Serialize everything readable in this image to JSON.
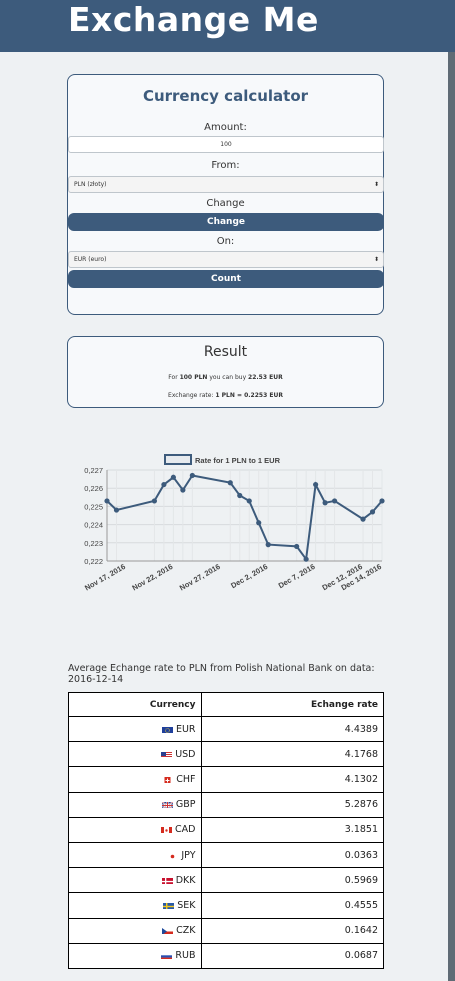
{
  "header": {
    "brand": "Exchange Me"
  },
  "calculator": {
    "title": "Currency calculator",
    "amount_label": "Amount:",
    "amount_value": "100",
    "from_label": "From:",
    "from_value": "PLN (złoty)",
    "change_label": "Change",
    "change_button": "Change",
    "on_label": "On:",
    "on_value": "EUR (euro)",
    "count_button": "Count",
    "caret": "⬍"
  },
  "result": {
    "title": "Result",
    "line1_a": "For ",
    "amount": "100 PLN",
    "line1_b": " you can buy ",
    "converted": "22.53 EUR",
    "rate_prefix": "Exchange rate: ",
    "rate": "1 PLN = 0.2253 EUR"
  },
  "chart_data": {
    "type": "line",
    "title": "",
    "legend": "Rate for 1 PLN to 1 EUR",
    "legend_position": "top-center",
    "grid": true,
    "ylim": [
      0.222,
      0.227
    ],
    "y_ticks": [
      "0,227",
      "0,226",
      "0,225",
      "0,224",
      "0,223",
      "0,222"
    ],
    "x_range": [
      "2016-11-15",
      "2016-12-14"
    ],
    "x_ticks": [
      {
        "label": "Nov 17, 2016",
        "date": "2016-11-17"
      },
      {
        "label": "Nov 22, 2016",
        "date": "2016-11-22"
      },
      {
        "label": "Nov 27, 2016",
        "date": "2016-11-27"
      },
      {
        "label": "Dec 2, 2016",
        "date": "2016-12-02"
      },
      {
        "label": "Dec 7, 2016",
        "date": "2016-12-07"
      },
      {
        "label": "Dec 12, 2016",
        "date": "2016-12-12"
      },
      {
        "label": "Dec 14, 2016",
        "date": "2016-12-14"
      }
    ],
    "series": [
      {
        "name": "Rate for 1 PLN to 1 EUR",
        "color": "#3d5b7c",
        "points": [
          {
            "x": "2016-11-15",
            "y": 0.2253
          },
          {
            "x": "2016-11-16",
            "y": 0.2248
          },
          {
            "x": "2016-11-20",
            "y": 0.2253
          },
          {
            "x": "2016-11-21",
            "y": 0.2262
          },
          {
            "x": "2016-11-22",
            "y": 0.2266
          },
          {
            "x": "2016-11-23",
            "y": 0.2259
          },
          {
            "x": "2016-11-24",
            "y": 0.2267
          },
          {
            "x": "2016-11-28",
            "y": 0.2263
          },
          {
            "x": "2016-11-29",
            "y": 0.2256
          },
          {
            "x": "2016-11-30",
            "y": 0.2253
          },
          {
            "x": "2016-12-01",
            "y": 0.2241
          },
          {
            "x": "2016-12-02",
            "y": 0.2229
          },
          {
            "x": "2016-12-05",
            "y": 0.2228
          },
          {
            "x": "2016-12-06",
            "y": 0.2221
          },
          {
            "x": "2016-12-07",
            "y": 0.2262
          },
          {
            "x": "2016-12-08",
            "y": 0.2252
          },
          {
            "x": "2016-12-09",
            "y": 0.2253
          },
          {
            "x": "2016-12-12",
            "y": 0.2243
          },
          {
            "x": "2016-12-13",
            "y": 0.2247
          },
          {
            "x": "2016-12-14",
            "y": 0.2253
          }
        ]
      }
    ]
  },
  "rates_section": {
    "caption": "Average Echange rate to PLN from Polish National Bank on data: 2016-12-14",
    "col_currency": "Currency",
    "col_rate": "Echange rate",
    "rows": [
      {
        "code": "EUR",
        "rate": "4.4389",
        "flag": "eu"
      },
      {
        "code": "USD",
        "rate": "4.1768",
        "flag": "us"
      },
      {
        "code": "CHF",
        "rate": "4.1302",
        "flag": "ch"
      },
      {
        "code": "GBP",
        "rate": "5.2876",
        "flag": "gb"
      },
      {
        "code": "CAD",
        "rate": "3.1851",
        "flag": "ca"
      },
      {
        "code": "JPY",
        "rate": "0.0363",
        "flag": "jp"
      },
      {
        "code": "DKK",
        "rate": "0.5969",
        "flag": "dk"
      },
      {
        "code": "SEK",
        "rate": "0.4555",
        "flag": "se"
      },
      {
        "code": "CZK",
        "rate": "0.1642",
        "flag": "cz"
      },
      {
        "code": "RUB",
        "rate": "0.0687",
        "flag": "ru"
      }
    ]
  }
}
